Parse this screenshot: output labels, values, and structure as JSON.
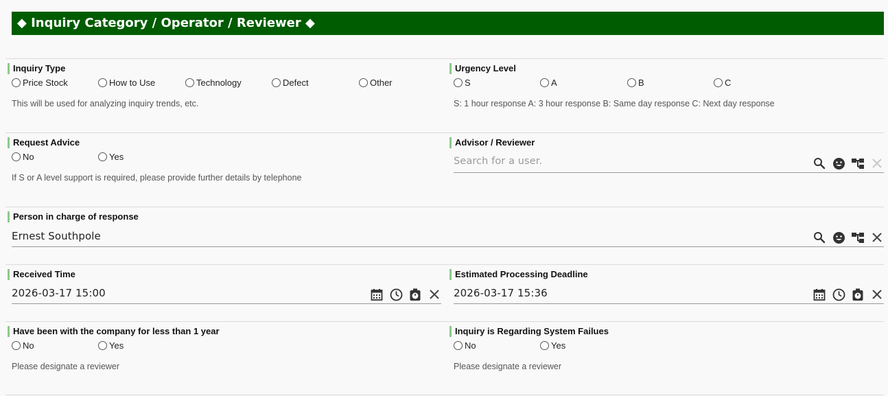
{
  "header": {
    "title": "◆ Inquiry Category / Operator / Reviewer ◆"
  },
  "inquiry_type": {
    "label": "Inquiry Type",
    "options": [
      "Price Stock",
      "How to Use",
      "Technology",
      "Defect",
      "Other"
    ],
    "help": "This will be used for analyzing inquiry trends, etc."
  },
  "urgency": {
    "label": "Urgency Level",
    "options": [
      "S",
      "A",
      "B",
      "C"
    ],
    "help": "S: 1 hour response A: 3 hour response B: Same day response C: Next day response"
  },
  "request_advice": {
    "label": "Request Advice",
    "options": [
      "No",
      "Yes"
    ],
    "help": "If S or A level support is required, please provide further details by telephone"
  },
  "advisor": {
    "label": "Advisor / Reviewer",
    "placeholder": "Search for a user.",
    "value": ""
  },
  "person_in_charge": {
    "label": "Person in charge of response",
    "value": "Ernest Southpole"
  },
  "received_time": {
    "label": "Received Time",
    "value": "2026-03-17 15:00"
  },
  "deadline": {
    "label": "Estimated Processing Deadline",
    "value": "2026-03-17 15:36"
  },
  "less_than_year": {
    "label": "Have been with the company for less than 1 year",
    "options": [
      "No",
      "Yes"
    ],
    "help": "Please designate a reviewer"
  },
  "system_failures": {
    "label": "Inquiry is Regarding System Failues",
    "options": [
      "No",
      "Yes"
    ],
    "help": "Please designate a reviewer"
  },
  "icons": {
    "user_field": [
      "search-icon",
      "smiley-icon",
      "org-tree-icon",
      "close-icon"
    ],
    "datetime_field": [
      "calendar-icon",
      "clock-icon",
      "timer-icon",
      "close-icon"
    ]
  },
  "colors": {
    "header_bg": "#005c00",
    "label_accent": "#8cc98c"
  }
}
